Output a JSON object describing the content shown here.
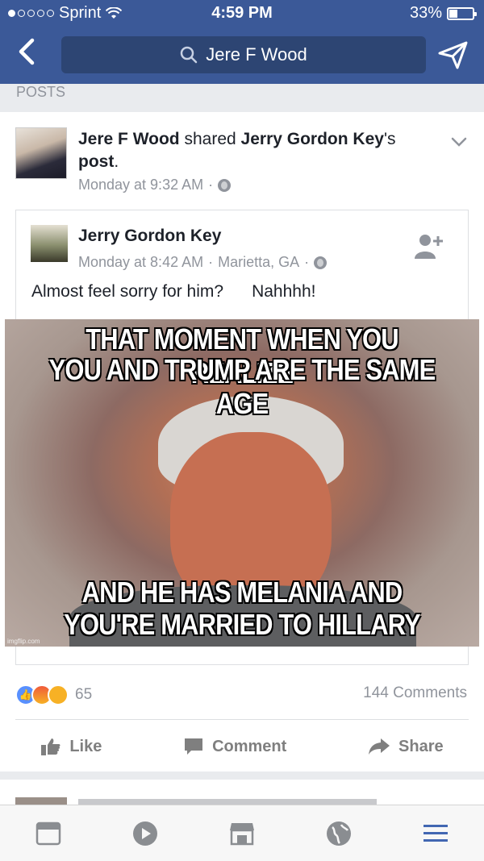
{
  "status_bar": {
    "carrier": "Sprint",
    "time": "4:59 PM",
    "battery": "33%",
    "battery_level": 0.33
  },
  "header": {
    "search_query": "Jere F Wood"
  },
  "section_label": "POSTS",
  "post": {
    "author": "Jere F Wood",
    "action": "shared",
    "shared_owner": "Jerry Gordon Key",
    "possessive": "'s",
    "object": "post",
    "period": ".",
    "timestamp": "Monday at 9:32 AM",
    "dot": "·",
    "shared_post": {
      "author": "Jerry Gordon Key",
      "timestamp": "Monday at 8:42 AM",
      "location": "Marietta, GA",
      "message": "Almost feel sorry for him?      Nahhhh!",
      "meme": {
        "top_line_1": "THAT MOMENT WHEN YOU REALIZE",
        "top_line_2": "YOU AND TRUMP ARE THE SAME AGE",
        "bottom_line_1": "AND HE HAS MELANIA AND",
        "bottom_line_2": "YOU'RE MARRIED TO HILLARY",
        "watermark": "imgflip.com"
      }
    },
    "reaction_count": "65",
    "comments": "144 Comments",
    "actions": {
      "like": "Like",
      "comment": "Comment",
      "share": "Share"
    }
  },
  "colors": {
    "brand": "#3b5998",
    "muted": "#90949c"
  }
}
